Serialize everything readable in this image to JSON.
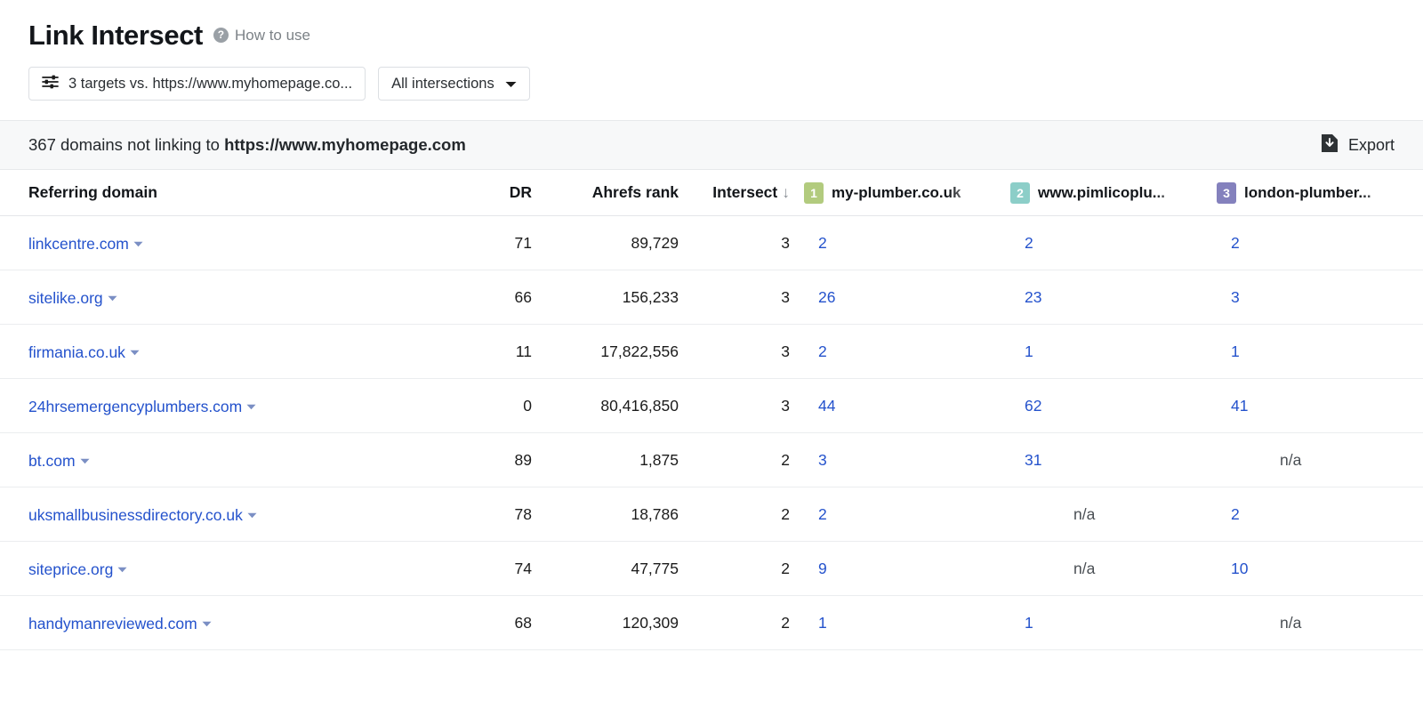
{
  "header": {
    "title": "Link Intersect",
    "help_icon": "question-mark-icon",
    "help_label": "How to use"
  },
  "controls": {
    "targets_filter": {
      "icon": "tune-sliders-icon",
      "label": "3 targets vs. https://www.myhomepage.co..."
    },
    "intersections_select": {
      "label": "All intersections",
      "icon": "chevron-down-icon"
    }
  },
  "subheader": {
    "count_text": "367 domains not linking to ",
    "target_url": "https://www.myhomepage.com",
    "export": {
      "icon": "download-file-icon",
      "label": "Export"
    }
  },
  "table": {
    "columns": {
      "domain": "Referring domain",
      "dr": "DR",
      "rank": "Ahrefs rank",
      "intersect": "Intersect",
      "sort_indicator": "↓"
    },
    "targets": [
      {
        "index": "1",
        "name": "my-plumber.co.uk",
        "color": "#b2cb7e"
      },
      {
        "index": "2",
        "name": "www.pimlicoplu...",
        "color": "#8ccec8"
      },
      {
        "index": "3",
        "name": "london-plumber...",
        "color": "#8481bd"
      }
    ],
    "rows": [
      {
        "domain": "linkcentre.com",
        "dr": "71",
        "rank": "89,729",
        "intersect": "3",
        "t1": "2",
        "t2": "2",
        "t3": "2"
      },
      {
        "domain": "sitelike.org",
        "dr": "66",
        "rank": "156,233",
        "intersect": "3",
        "t1": "26",
        "t2": "23",
        "t3": "3"
      },
      {
        "domain": "firmania.co.uk",
        "dr": "11",
        "rank": "17,822,556",
        "intersect": "3",
        "t1": "2",
        "t2": "1",
        "t3": "1"
      },
      {
        "domain": "24hrsemergencyplumbers.com",
        "dr": "0",
        "rank": "80,416,850",
        "intersect": "3",
        "t1": "44",
        "t2": "62",
        "t3": "41"
      },
      {
        "domain": "bt.com",
        "dr": "89",
        "rank": "1,875",
        "intersect": "2",
        "t1": "3",
        "t2": "31",
        "t3": "n/a"
      },
      {
        "domain": "uksmallbusinessdirectory.co.uk",
        "dr": "78",
        "rank": "18,786",
        "intersect": "2",
        "t1": "2",
        "t2": "n/a",
        "t3": "2"
      },
      {
        "domain": "siteprice.org",
        "dr": "74",
        "rank": "47,775",
        "intersect": "2",
        "t1": "9",
        "t2": "n/a",
        "t3": "10"
      },
      {
        "domain": "handymanreviewed.com",
        "dr": "68",
        "rank": "120,309",
        "intersect": "2",
        "t1": "1",
        "t2": "1",
        "t3": "n/a"
      }
    ]
  },
  "colors": {
    "link": "#2452cc",
    "badge_1": "#b2cb7e",
    "badge_2": "#8ccec8",
    "badge_3": "#8481bd"
  }
}
